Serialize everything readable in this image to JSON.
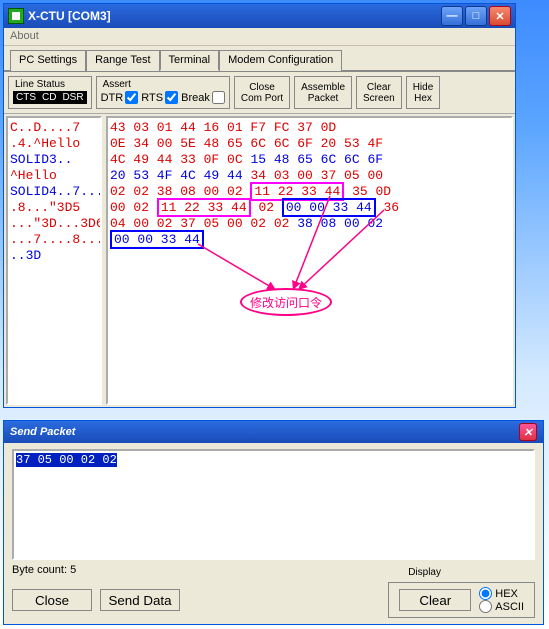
{
  "window": {
    "title": "X-CTU  [COM3]",
    "menu_about": "About"
  },
  "tabs": [
    "PC Settings",
    "Range Test",
    "Terminal",
    "Modem Configuration"
  ],
  "active_tab": 2,
  "toolbar": {
    "line_status_label": "Line Status",
    "cts": "CTS",
    "cd": "CD",
    "dsr": "DSR",
    "assert_label": "Assert",
    "dtr": "DTR",
    "rts": "RTS",
    "break": "Break",
    "close_comport": "Close\nCom Port",
    "assemble_packet": "Assemble\nPacket",
    "clear_screen": "Clear\nScreen",
    "hide_hex": "Hide\nHex"
  },
  "term_left": [
    {
      "t": "C..D....7",
      "c": "red"
    },
    {
      "t": ".4.^Hello",
      "c": "red"
    },
    {
      "t": "SOLID3..",
      "c": "blue"
    },
    {
      "t": "^Hello",
      "c": "red"
    },
    {
      "t": "SOLID4..7...",
      "c": "blue"
    },
    {
      "t": ".8...\"3D5",
      "c": "red"
    },
    {
      "t": "...\"3D...3D6",
      "c": "red"
    },
    {
      "t": "...7....8...",
      "c": "red"
    },
    {
      "t": "..3D",
      "c": "blue"
    }
  ],
  "term_hex": [
    [
      [
        "43 03 01 44 16 01 F7 FC 37 0D",
        "red"
      ]
    ],
    [
      [
        "0E 34 00 5E 48 65 6C 6C 6F 20 53 4F",
        "red"
      ]
    ],
    [
      [
        "4C 49 44 33 0F 0C ",
        "red"
      ],
      [
        "15 48 65 6C 6C 6F",
        "blue"
      ]
    ],
    [
      [
        "20 53 4F 4C 49 44 ",
        "blue"
      ],
      [
        "34 03 00 37 05 00",
        "red"
      ]
    ],
    [
      [
        "02 02 38 08 00 02 ",
        "red"
      ],
      [
        "11 22 33 44",
        "red",
        "mag"
      ],
      [
        " 35 0D",
        "red"
      ]
    ],
    [
      [
        "00 02 ",
        "red"
      ],
      [
        "11 22 33 44",
        "red",
        "mag"
      ],
      [
        " 02 ",
        "red"
      ],
      [
        "00 00 33 44",
        "blue",
        "blue"
      ],
      [
        " 36",
        "red"
      ]
    ],
    [
      [
        "04 00 02 37 05 00 02 02",
        "red"
      ],
      [
        " 38 08 00 02",
        "blue"
      ]
    ],
    [
      [
        "00 00 33 44",
        "blue",
        "mag"
      ]
    ]
  ],
  "annotation": "修改访问口令",
  "send_packet": {
    "title": "Send Packet",
    "content": "37 05 00 02 02",
    "byte_count_label": "Byte count:  5",
    "close_btn": "Close",
    "send_btn": "Send Data",
    "clear_btn": "Clear",
    "display_label": "Display",
    "hex": "HEX",
    "ascii": "ASCII"
  }
}
